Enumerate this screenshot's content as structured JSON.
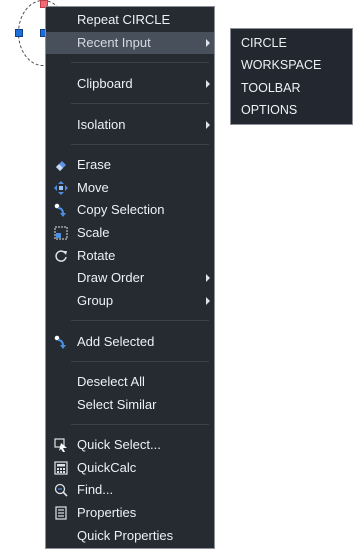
{
  "context_menu": {
    "items": [
      {
        "label": "Repeat CIRCLE",
        "icon": null,
        "submenu": false
      },
      {
        "label": "Recent Input",
        "icon": null,
        "submenu": true
      },
      {
        "label": "Clipboard",
        "icon": null,
        "submenu": true
      },
      {
        "label": "Isolation",
        "icon": null,
        "submenu": true
      },
      {
        "label": "Erase",
        "icon": "eraser-icon",
        "submenu": false
      },
      {
        "label": "Move",
        "icon": "move-icon",
        "submenu": false
      },
      {
        "label": "Copy Selection",
        "icon": "copy-selection-icon",
        "submenu": false
      },
      {
        "label": "Scale",
        "icon": "scale-icon",
        "submenu": false
      },
      {
        "label": "Rotate",
        "icon": "rotate-icon",
        "submenu": false
      },
      {
        "label": "Draw Order",
        "icon": null,
        "submenu": true
      },
      {
        "label": "Group",
        "icon": null,
        "submenu": true
      },
      {
        "label": "Add Selected",
        "icon": "add-selected-icon",
        "submenu": false
      },
      {
        "label": "Deselect All",
        "icon": null,
        "submenu": false
      },
      {
        "label": "Select Similar",
        "icon": null,
        "submenu": false
      },
      {
        "label": "Quick Select...",
        "icon": "quick-select-icon",
        "submenu": false
      },
      {
        "label": "QuickCalc",
        "icon": "calculator-icon",
        "submenu": false
      },
      {
        "label": "Find...",
        "icon": "find-icon",
        "submenu": false
      },
      {
        "label": "Properties",
        "icon": "properties-icon",
        "submenu": false
      },
      {
        "label": "Quick Properties",
        "icon": null,
        "submenu": false
      }
    ],
    "highlighted_item": "Recent Input"
  },
  "recent_input_submenu": {
    "items": [
      {
        "label": "CIRCLE"
      },
      {
        "label": "WORKSPACE"
      },
      {
        "label": "TOOLBAR"
      },
      {
        "label": "OPTIONS"
      }
    ]
  },
  "colors": {
    "menu_background": "#262a31",
    "menu_border": "#8b9098",
    "menu_text": "#eef1f4",
    "hover_background": "#48505b",
    "grip_blue": "#1e6fd9",
    "grip_hot": "#f06b73"
  }
}
